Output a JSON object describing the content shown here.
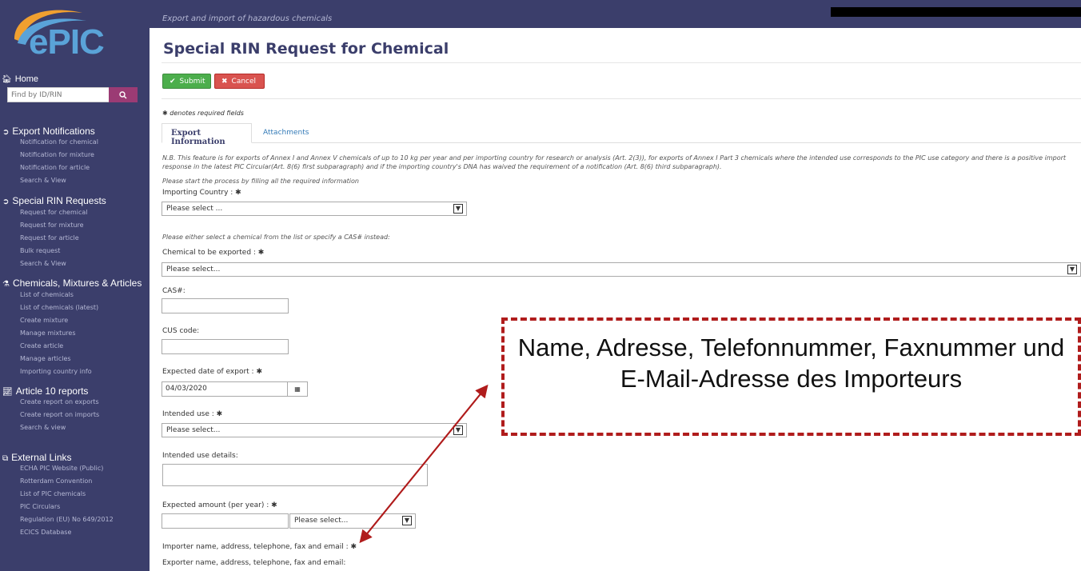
{
  "app": {
    "logo_text": "ePIC",
    "subtitle": "Export and import of hazardous chemicals"
  },
  "sidebar": {
    "home_label": "Home",
    "search_placeholder": "Find by ID/RIN",
    "sections": [
      {
        "title": "Export Notifications",
        "items": [
          "Notification for chemical",
          "Notification for mixture",
          "Notification for article",
          "Search & View"
        ]
      },
      {
        "title": "Special RIN Requests",
        "items": [
          "Request for chemical",
          "Request for mixture",
          "Request for article",
          "Bulk request",
          "Search & View"
        ]
      },
      {
        "title": "Chemicals, Mixtures & Articles",
        "items": [
          "List of chemicals",
          "List of chemicals (latest)",
          "Create mixture",
          "Manage mixtures",
          "Create article",
          "Manage articles",
          "Importing country info"
        ]
      },
      {
        "title": "Article 10 reports",
        "items": [
          "Create report on exports",
          "Create report on imports",
          "Search & view"
        ]
      },
      {
        "title": "External Links",
        "items": [
          "ECHA PIC Website (Public)",
          "Rotterdam Convention",
          "List of PIC chemicals",
          "PIC Circulars",
          "Regulation (EU) No 649/2012",
          "ECICS Database"
        ]
      }
    ]
  },
  "page": {
    "title": "Special RIN Request for Chemical",
    "submit_label": "Submit",
    "cancel_label": "Cancel",
    "required_note": "denotes required fields",
    "tabs": [
      "Export Information",
      "Attachments"
    ],
    "nb_note": "N.B. This feature is for exports of Annex I and Annex V chemicals of up to 10 kg per year and per importing country for research or analysis (Art. 2(3)), for exports of Annex I Part 3 chemicals where the intended use corresponds to the PIC use category and there is a positive import response in the latest PIC Circular(Art. 8(6) first subparagraph) and if the importing country's DNA has waived the requirement of a notification (Art. 8(6) third subparagraph).",
    "start_note": "Please start the process by filling all the required information",
    "either_note": "Please either select a chemical from the list or specify a CAS# instead:"
  },
  "form": {
    "importing_country_label": "Importing Country :",
    "importing_country_value": "Please select ...",
    "chemical_label": "Chemical to be exported :",
    "chemical_value": "Please select...",
    "cas_label": "CAS#:",
    "cas_value": "",
    "cus_label": "CUS code:",
    "cus_value": "",
    "export_date_label": "Expected date of export :",
    "export_date_value": "04/03/2020",
    "intended_use_label": "Intended use :",
    "intended_use_value": "Please select...",
    "intended_use_details_label": "Intended use details:",
    "amount_label": "Expected amount (per year) :",
    "amount_value": "",
    "amount_unit_value": "Please select...",
    "importer_label": "Importer name, address, telephone, fax and email :",
    "exporter_label": "Exporter name, address, telephone, fax and email:"
  },
  "annotation": {
    "text": "Name, Adresse, Telefonnummer, Faxnummer und E-Mail-Adresse des Importeurs",
    "border_color": "#b01c1c"
  }
}
